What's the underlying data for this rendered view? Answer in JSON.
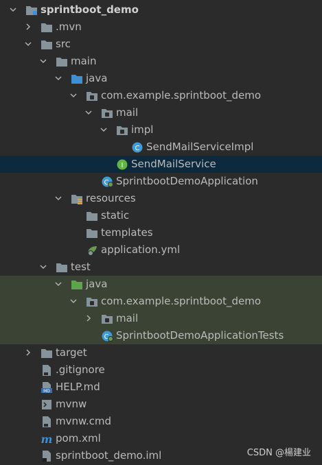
{
  "tree": [
    {
      "label": "sprintboot_demo",
      "level": 0,
      "arrow": "down",
      "icon": "module-folder-icon",
      "bold": true
    },
    {
      "label": ".mvn",
      "level": 1,
      "arrow": "right",
      "icon": "folder-icon"
    },
    {
      "label": "src",
      "level": 1,
      "arrow": "down",
      "icon": "folder-icon"
    },
    {
      "label": "main",
      "level": 2,
      "arrow": "down",
      "icon": "folder-icon"
    },
    {
      "label": "java",
      "level": 3,
      "arrow": "down",
      "icon": "source-folder-icon"
    },
    {
      "label": "com.example.sprintboot_demo",
      "level": 4,
      "arrow": "down",
      "icon": "package-icon"
    },
    {
      "label": "mail",
      "level": 5,
      "arrow": "down",
      "icon": "package-icon"
    },
    {
      "label": "impl",
      "level": 6,
      "arrow": "down",
      "icon": "package-icon"
    },
    {
      "label": "SendMailServiceImpl",
      "level": 7,
      "arrow": "none",
      "icon": "class-icon"
    },
    {
      "label": "SendMailService",
      "level": 6,
      "arrow": "none",
      "icon": "interface-icon",
      "selected": true
    },
    {
      "label": "SprintbootDemoApplication",
      "level": 5,
      "arrow": "none",
      "icon": "spring-class-icon"
    },
    {
      "label": "resources",
      "level": 3,
      "arrow": "down",
      "icon": "resources-folder-icon"
    },
    {
      "label": "static",
      "level": 4,
      "arrow": "none",
      "icon": "folder-icon"
    },
    {
      "label": "templates",
      "level": 4,
      "arrow": "none",
      "icon": "folder-icon"
    },
    {
      "label": "application.yml",
      "level": 4,
      "arrow": "none",
      "icon": "spring-yml-icon"
    },
    {
      "label": "test",
      "level": 2,
      "arrow": "down",
      "icon": "folder-icon"
    },
    {
      "label": "java",
      "level": 3,
      "arrow": "down",
      "icon": "test-folder-icon",
      "testbg": true
    },
    {
      "label": "com.example.sprintboot_demo",
      "level": 4,
      "arrow": "down",
      "icon": "package-icon",
      "testbg": true
    },
    {
      "label": "mail",
      "level": 5,
      "arrow": "right",
      "icon": "package-icon",
      "testbg": true
    },
    {
      "label": "SprintbootDemoApplicationTests",
      "level": 5,
      "arrow": "none",
      "icon": "spring-class-icon",
      "testbg": true
    },
    {
      "label": "target",
      "level": 1,
      "arrow": "right",
      "icon": "folder-icon"
    },
    {
      "label": ".gitignore",
      "level": 1,
      "arrow": "none",
      "icon": "text-file-icon"
    },
    {
      "label": "HELP.md",
      "level": 1,
      "arrow": "none",
      "icon": "markdown-file-icon"
    },
    {
      "label": "mvnw",
      "level": 1,
      "arrow": "none",
      "icon": "shell-file-icon"
    },
    {
      "label": "mvnw.cmd",
      "level": 1,
      "arrow": "none",
      "icon": "text-file-icon"
    },
    {
      "label": "pom.xml",
      "level": 1,
      "arrow": "none",
      "icon": "maven-icon"
    },
    {
      "label": "sprintboot_demo.iml",
      "level": 1,
      "arrow": "none",
      "icon": "iml-file-icon"
    }
  ],
  "watermark": "CSDN @楊建业",
  "colors": {
    "background": "#2b2b2b",
    "selected": "#0d293e",
    "test_highlight": "#3b4434",
    "folder": "#87939a",
    "source_folder": "#3d8fd6",
    "test_folder": "#5fa34b",
    "class": "#3f9bd6",
    "interface": "#62b543"
  }
}
